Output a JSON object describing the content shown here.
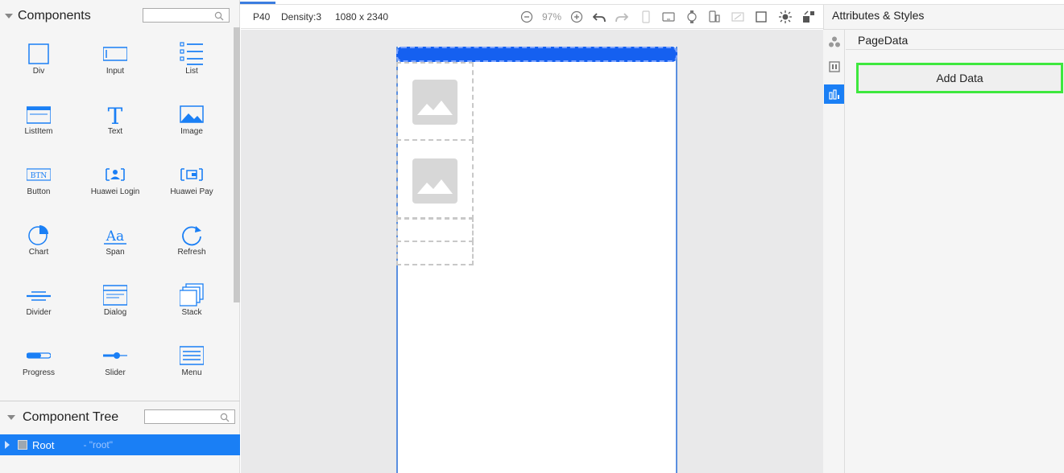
{
  "components_panel": {
    "title": "Components",
    "items": [
      {
        "label": "Div",
        "icon": "div-icon"
      },
      {
        "label": "Input",
        "icon": "input-icon"
      },
      {
        "label": "List",
        "icon": "list-icon"
      },
      {
        "label": "ListItem",
        "icon": "listitem-icon"
      },
      {
        "label": "Text",
        "icon": "text-icon"
      },
      {
        "label": "Image",
        "icon": "image-icon"
      },
      {
        "label": "Button",
        "icon": "button-icon"
      },
      {
        "label": "Huawei Login",
        "icon": "huawei-login-icon"
      },
      {
        "label": "Huawei Pay",
        "icon": "huawei-pay-icon"
      },
      {
        "label": "Chart",
        "icon": "chart-icon"
      },
      {
        "label": "Span",
        "icon": "span-icon"
      },
      {
        "label": "Refresh",
        "icon": "refresh-icon"
      },
      {
        "label": "Divider",
        "icon": "divider-icon"
      },
      {
        "label": "Dialog",
        "icon": "dialog-icon"
      },
      {
        "label": "Stack",
        "icon": "stack-icon"
      },
      {
        "label": "Progress",
        "icon": "progress-icon"
      },
      {
        "label": "Slider",
        "icon": "slider-icon"
      },
      {
        "label": "Menu",
        "icon": "menu-icon"
      }
    ],
    "text_icon_glyph": "T",
    "button_icon_glyph": "BTN",
    "span_icon_glyph": "Aa"
  },
  "tree_panel": {
    "title": "Component Tree",
    "root": {
      "name": "Root",
      "id": "- \"root\""
    }
  },
  "toolbar": {
    "device": "P40",
    "density": "Density:3",
    "resolution": "1080 x 2340",
    "zoom": "97%"
  },
  "right_panel": {
    "title": "Attributes & Styles",
    "section": "PageData",
    "add_button": "Add Data"
  },
  "colors": {
    "accent": "#1a7ff5",
    "phone_header": "#1560f0",
    "highlight": "#3ee83e"
  }
}
